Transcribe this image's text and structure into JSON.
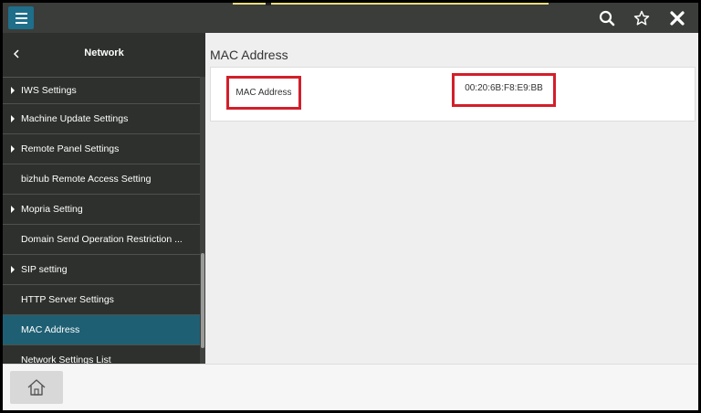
{
  "sidebar": {
    "title": "Network",
    "items": [
      {
        "label": "IWS Settings",
        "expandable": true
      },
      {
        "label": "Machine Update Settings",
        "expandable": true
      },
      {
        "label": "Remote Panel Settings",
        "expandable": true
      },
      {
        "label": "bizhub Remote Access Setting",
        "expandable": false
      },
      {
        "label": "Mopria Setting",
        "expandable": true
      },
      {
        "label": "Domain Send Operation Restriction ...",
        "expandable": false
      },
      {
        "label": "SIP setting",
        "expandable": true
      },
      {
        "label": "HTTP Server Settings",
        "expandable": false
      },
      {
        "label": "MAC Address",
        "expandable": false,
        "selected": true
      },
      {
        "label": "Network Settings List",
        "expandable": false
      }
    ]
  },
  "main": {
    "title": "MAC Address",
    "field_label": "MAC Address",
    "field_value": "00:20:6B:F8:E9:BB"
  },
  "icons": {
    "menu": "hamburger-menu-icon",
    "search": "search-icon",
    "favorite": "star-icon",
    "close": "close-icon",
    "back": "chevron-left-icon",
    "home": "home-icon"
  },
  "colors": {
    "accent": "#1f6e8a",
    "selected_item": "#1e5f73",
    "highlight_box": "#d21f2a",
    "topbar": "#3a3d3a",
    "sidebar": "#2d302d"
  }
}
